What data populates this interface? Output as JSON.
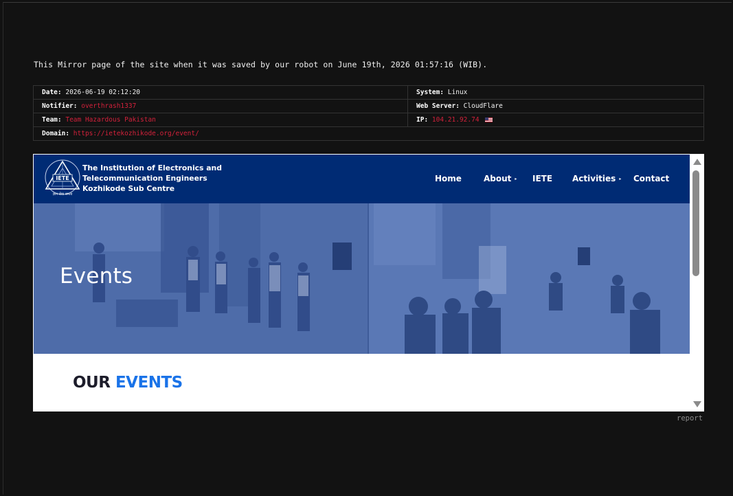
{
  "mirror_note": "This Mirror page of the site when it was saved by our robot on June 19th, 2026 01:57:16 (WIB).",
  "info": {
    "date_label": "Date:",
    "date_value": "2026-06-19 02:12:20",
    "system_label": "System:",
    "system_value": "Linux",
    "notifier_label": "Notifier:",
    "notifier_value": "overthrash1337",
    "webserver_label": "Web Server:",
    "webserver_value": "CloudFlare",
    "team_label": "Team:",
    "team_value": "Team Hazardous Pakistan",
    "ip_label": "IP:",
    "ip_value": "104.21.92.74",
    "domain_label": "Domain:",
    "domain_value": "https://ietekozhikode.org/event/",
    "flag_icon": "us-flag-icon"
  },
  "site": {
    "logo_text": "IETE",
    "logo_caption": "ज्ञान सेवा समता",
    "org_line1": "The Institution of Electronics and",
    "org_line2": "Telecommunication Engineers",
    "org_line3": "Kozhikode Sub Centre",
    "nav": {
      "home": "Home",
      "about": "About",
      "iete": "IETE",
      "activities": "Activities",
      "contact": "Contact"
    },
    "hero_title": "Events",
    "section_title_dark": "OUR",
    "section_title_blue": "EVENTS"
  },
  "report_label": "report",
  "colors": {
    "background": "#121212",
    "header_blue": "#002b74",
    "hero_overlay": "#4e6aa5",
    "accent_blue": "#1a73e8",
    "link_red": "#d3213b"
  }
}
